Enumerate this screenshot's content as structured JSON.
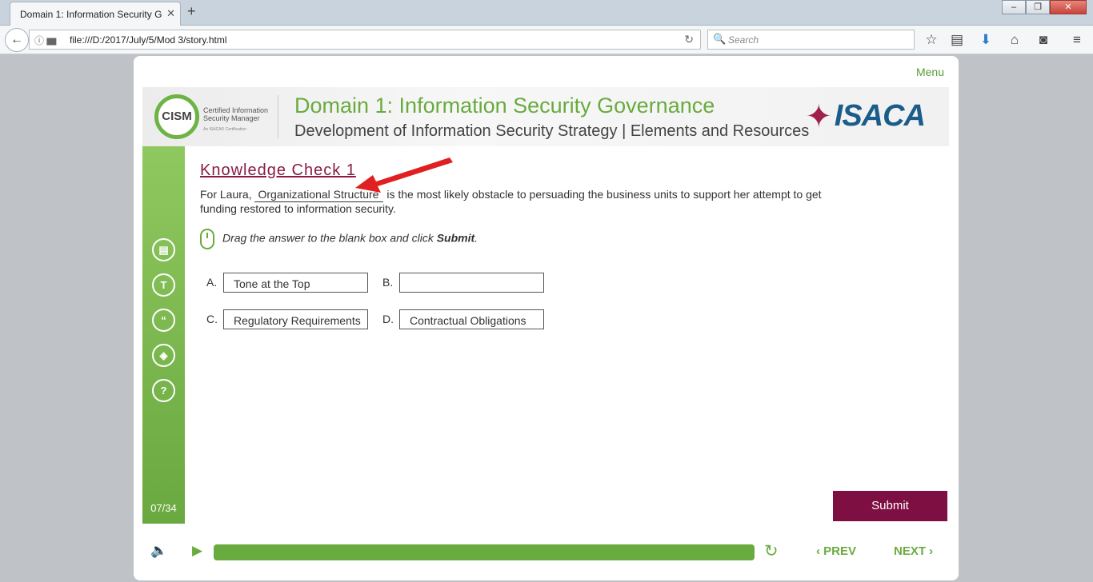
{
  "browser": {
    "tab_title": "Domain 1: Information Security G",
    "tab_close": "✕",
    "new_tab": "+",
    "url": "file:///D:/2017/July/5/Mod 3/story.html",
    "search_placeholder": "Search",
    "window_buttons": [
      "–",
      "❐",
      "✕"
    ]
  },
  "course": {
    "menu_label": "Menu",
    "logo_cism": "CISM",
    "logo_cism_text": "Certified Information Security Manager",
    "logo_cism_sub": "An ISACA® Certification",
    "header_title": "Domain 1: Information Security Governance",
    "header_subtitle": "Development of Information Security Strategy | Elements and Resources",
    "logo_isaca": "ISACA",
    "page_counter": "07/34",
    "kc_title": "Knowledge Check 1",
    "question_prefix": "For Laura,",
    "question_blank": "Organizational Structure",
    "question_suffix": "is the most likely obstacle to persuading the business units to support her attempt to get funding restored to information security.",
    "instruction_text": "Drag the answer to the blank box and click",
    "instruction_bold": "Submit",
    "instruction_end": ".",
    "options": [
      {
        "letter": "A.",
        "text": "Tone at the Top"
      },
      {
        "letter": "B.",
        "text": ""
      },
      {
        "letter": "C.",
        "text": "Regulatory Requirements"
      },
      {
        "letter": "D.",
        "text": "Contractual Obligations"
      }
    ],
    "submit_label": "Submit",
    "prev_label": "PREV",
    "next_label": "NEXT",
    "progress_fraction": 1.0,
    "accent_color": "#6aab3f",
    "brand_color": "#7e0f42"
  }
}
